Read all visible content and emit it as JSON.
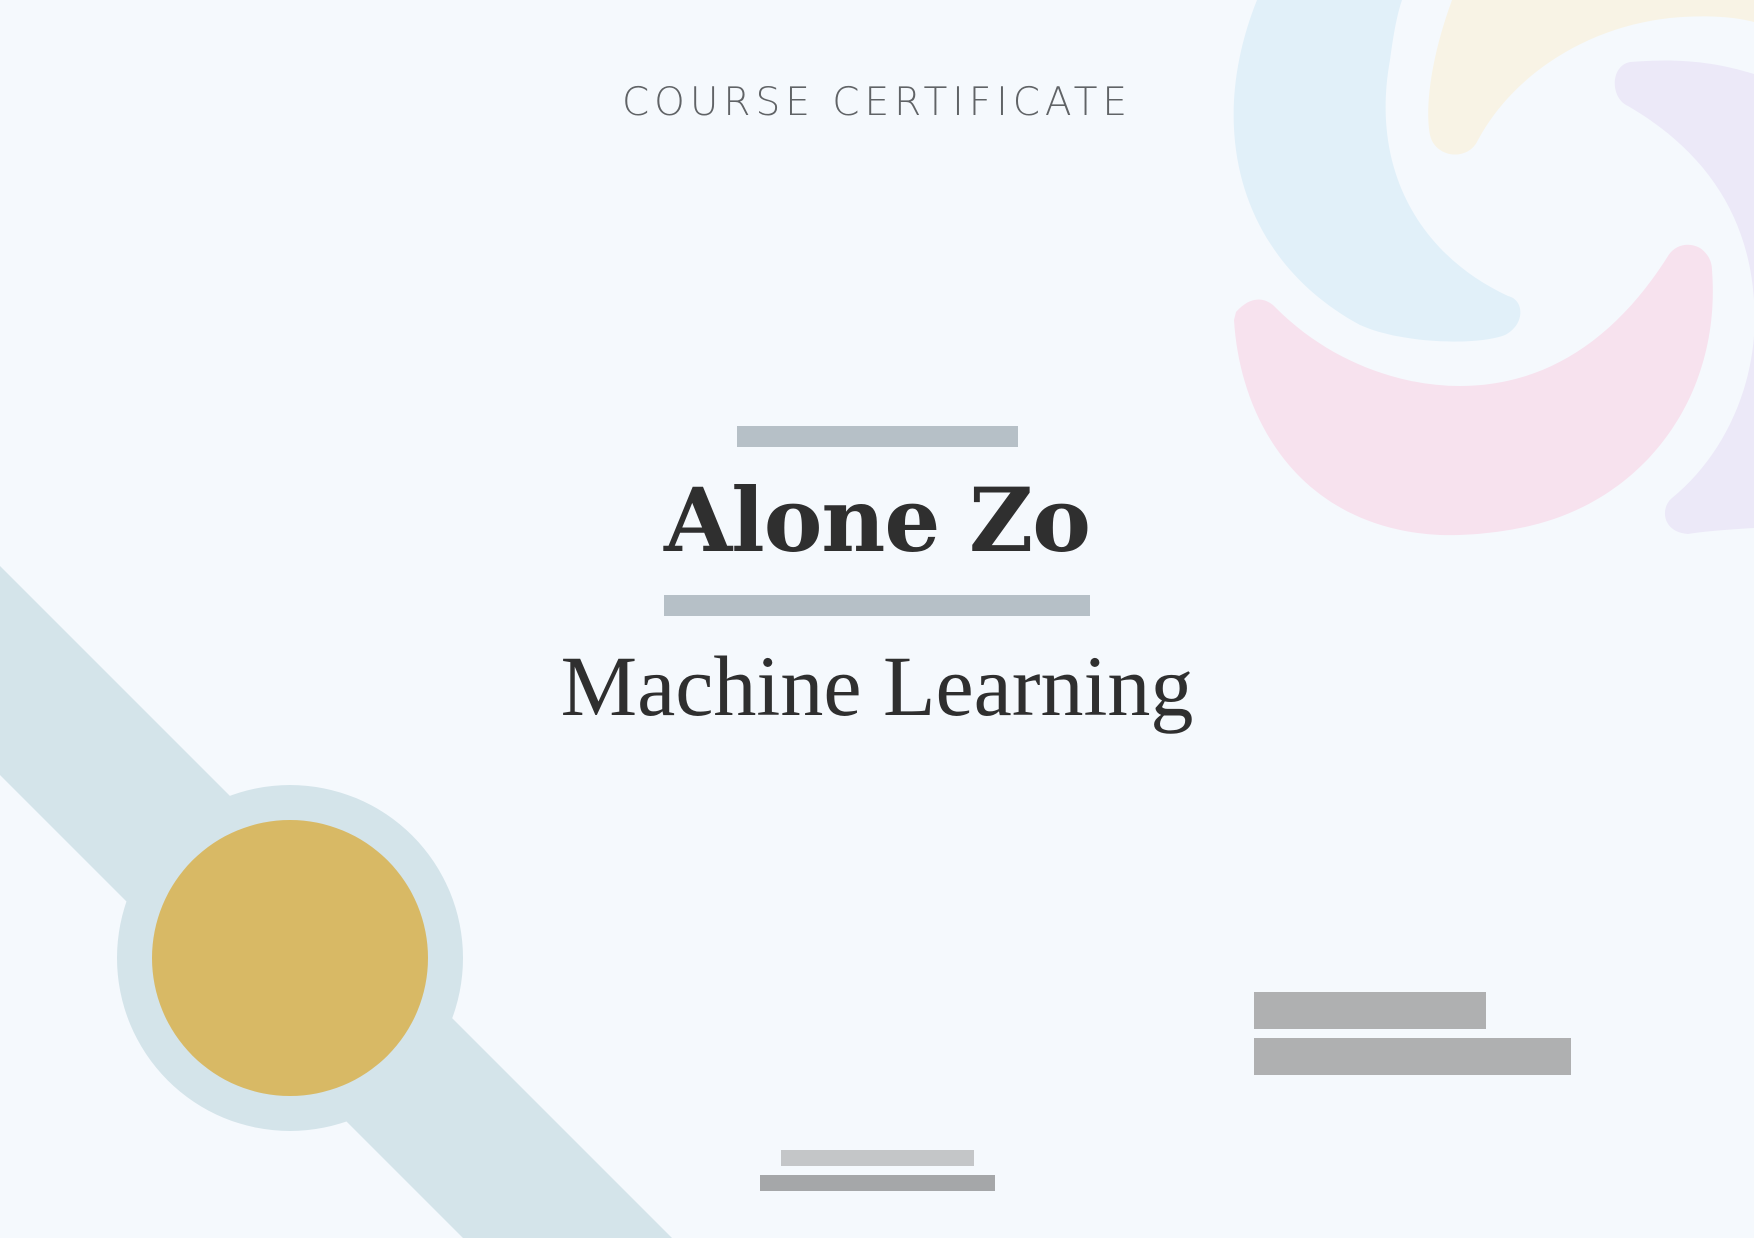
{
  "certificate": {
    "heading": "COURSE CERTIFICATE",
    "recipient_name": "Alone Zo",
    "course_name": "Machine Learning"
  },
  "colors": {
    "background": "#f5f9fd",
    "text": "#2f2f2f",
    "heading_text": "#606366",
    "ribbon": "#d4e4ea",
    "seal": "#d8b965",
    "swirl_blue": "#e1f0f9",
    "swirl_yellow": "#f8f3e5",
    "swirl_purple": "#ece9f8",
    "swirl_pink": "#f7e2ee",
    "placeholder_bar": "#b6c0c7",
    "signature_bar": "#afb0b1"
  },
  "icons": {
    "seal": "award-seal-icon",
    "ribbon": "ribbon-icon",
    "swirl": "swirl-logo-icon"
  }
}
